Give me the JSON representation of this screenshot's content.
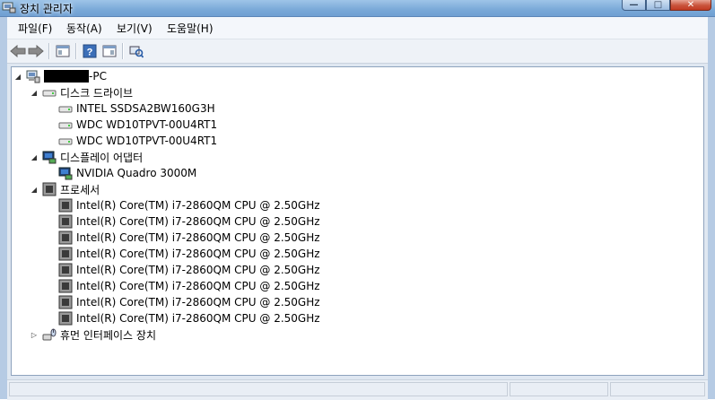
{
  "window": {
    "title": "장치 관리자",
    "buttons": {
      "minimize": "—",
      "maximize": "□",
      "close": "✕"
    }
  },
  "menu": [
    {
      "label": "파일(F)"
    },
    {
      "label": "동작(A)"
    },
    {
      "label": "보기(V)"
    },
    {
      "label": "도움말(H)"
    }
  ],
  "toolbar": [
    "back-icon",
    "forward-icon",
    "properties-icon",
    "help-icon",
    "view-icon",
    "scan-hardware-icon"
  ],
  "tree": {
    "root_suffix": "-PC",
    "groups": [
      {
        "label": "디스크 드라이브",
        "expanded": true,
        "items": [
          "INTEL SSDSA2BW160G3H",
          "WDC WD10TPVT-00U4RT1",
          "WDC WD10TPVT-00U4RT1"
        ]
      },
      {
        "label": "디스플레이 어댑터",
        "expanded": true,
        "items": [
          "NVIDIA Quadro 3000M"
        ]
      },
      {
        "label": "프로세서",
        "expanded": true,
        "items": [
          "Intel(R) Core(TM) i7-2860QM CPU @ 2.50GHz",
          "Intel(R) Core(TM) i7-2860QM CPU @ 2.50GHz",
          "Intel(R) Core(TM) i7-2860QM CPU @ 2.50GHz",
          "Intel(R) Core(TM) i7-2860QM CPU @ 2.50GHz",
          "Intel(R) Core(TM) i7-2860QM CPU @ 2.50GHz",
          "Intel(R) Core(TM) i7-2860QM CPU @ 2.50GHz",
          "Intel(R) Core(TM) i7-2860QM CPU @ 2.50GHz",
          "Intel(R) Core(TM) i7-2860QM CPU @ 2.50GHz"
        ]
      },
      {
        "label": "휴먼 인터페이스 장치",
        "expanded": false,
        "items": []
      }
    ]
  }
}
